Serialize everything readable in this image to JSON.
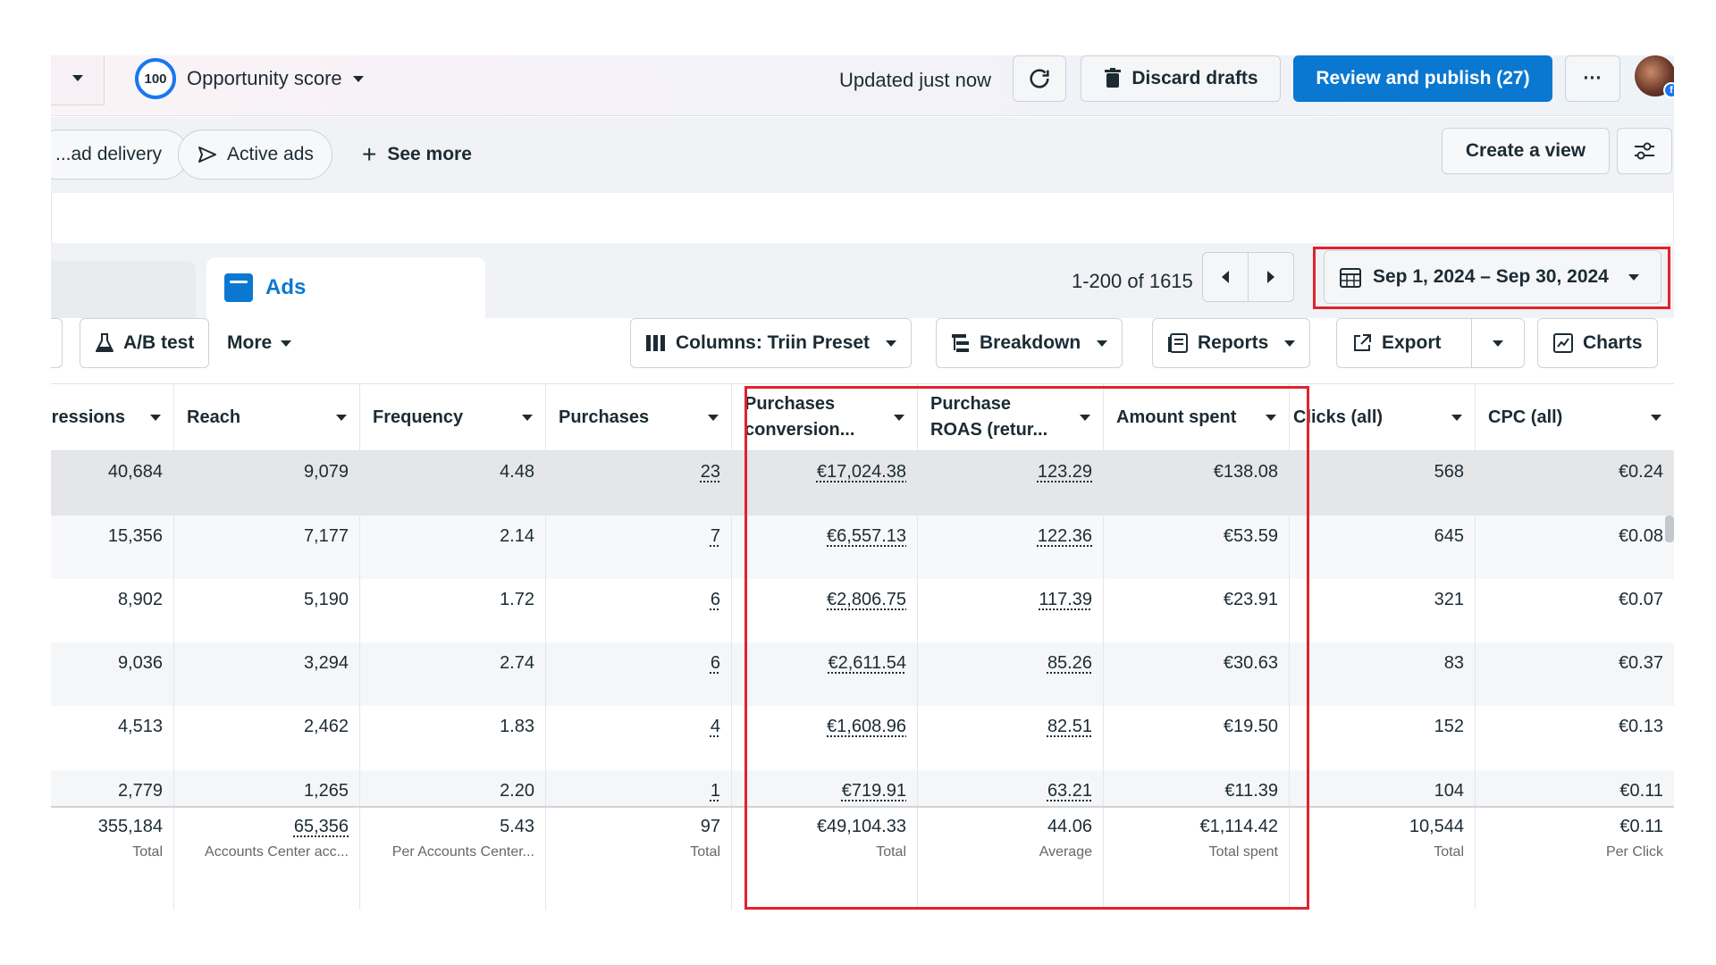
{
  "topbar": {
    "score": "100",
    "score_label": "Opportunity score",
    "updated": "Updated just now",
    "discard_label": "Discard drafts",
    "publish_label": "Review and publish (27)",
    "more_label": "···"
  },
  "filters": {
    "chip1": "...ad delivery",
    "chip2": "Active ads",
    "see_more": "See more",
    "create_view": "Create a view"
  },
  "tabs": {
    "active": "Ads"
  },
  "pager": {
    "range": "1-200 of 1615"
  },
  "date_range": "Sep 1, 2024 – Sep 30, 2024",
  "toolbar": {
    "ab_test": "A/B test",
    "more": "More",
    "columns": "Columns: Triin Preset",
    "breakdown": "Breakdown",
    "reports": "Reports",
    "export": "Export",
    "charts": "Charts"
  },
  "columns": [
    {
      "label": "...ressions"
    },
    {
      "label": "Reach"
    },
    {
      "label": "Frequency"
    },
    {
      "label": "Purchases"
    },
    {
      "label": "Purchases conversion..."
    },
    {
      "label": "Purchase ROAS (retur..."
    },
    {
      "label": "Amount spent"
    },
    {
      "label": "Clicks (all)"
    },
    {
      "label": "CPC (all)"
    }
  ],
  "rows": [
    {
      "impressions": "40,684",
      "reach": "9,079",
      "frequency": "4.48",
      "purchases": "23",
      "conv": "€17,024.38",
      "roas": "123.29",
      "spent": "€138.08",
      "clicks": "568",
      "cpc": "€0.24"
    },
    {
      "impressions": "15,356",
      "reach": "7,177",
      "frequency": "2.14",
      "purchases": "7",
      "conv": "€6,557.13",
      "roas": "122.36",
      "spent": "€53.59",
      "clicks": "645",
      "cpc": "€0.08"
    },
    {
      "impressions": "8,902",
      "reach": "5,190",
      "frequency": "1.72",
      "purchases": "6",
      "conv": "€2,806.75",
      "roas": "117.39",
      "spent": "€23.91",
      "clicks": "321",
      "cpc": "€0.07"
    },
    {
      "impressions": "9,036",
      "reach": "3,294",
      "frequency": "2.74",
      "purchases": "6",
      "conv": "€2,611.54",
      "roas": "85.26",
      "spent": "€30.63",
      "clicks": "83",
      "cpc": "€0.37"
    },
    {
      "impressions": "4,513",
      "reach": "2,462",
      "frequency": "1.83",
      "purchases": "4",
      "conv": "€1,608.96",
      "roas": "82.51",
      "spent": "€19.50",
      "clicks": "152",
      "cpc": "€0.13"
    },
    {
      "impressions": "2,779",
      "reach": "1,265",
      "frequency": "2.20",
      "purchases": "1",
      "conv": "€719.91",
      "roas": "63.21",
      "spent": "€11.39",
      "clicks": "104",
      "cpc": "€0.11"
    }
  ],
  "totals": {
    "impressions": {
      "value": "355,184",
      "label": "Total"
    },
    "reach": {
      "value": "65,356",
      "label": "Accounts Center acc..."
    },
    "frequency": {
      "value": "5.43",
      "label": "Per Accounts Center..."
    },
    "purchases": {
      "value": "97",
      "label": "Total"
    },
    "conv": {
      "value": "€49,104.33",
      "label": "Total"
    },
    "roas": {
      "value": "44.06",
      "label": "Average"
    },
    "spent": {
      "value": "€1,114.42",
      "label": "Total spent"
    },
    "clicks": {
      "value": "10,544",
      "label": "Total"
    },
    "cpc": {
      "value": "€0.11",
      "label": "Per Click"
    }
  },
  "colors": {
    "primary": "#0a78d1",
    "highlight": "#e0222c"
  }
}
